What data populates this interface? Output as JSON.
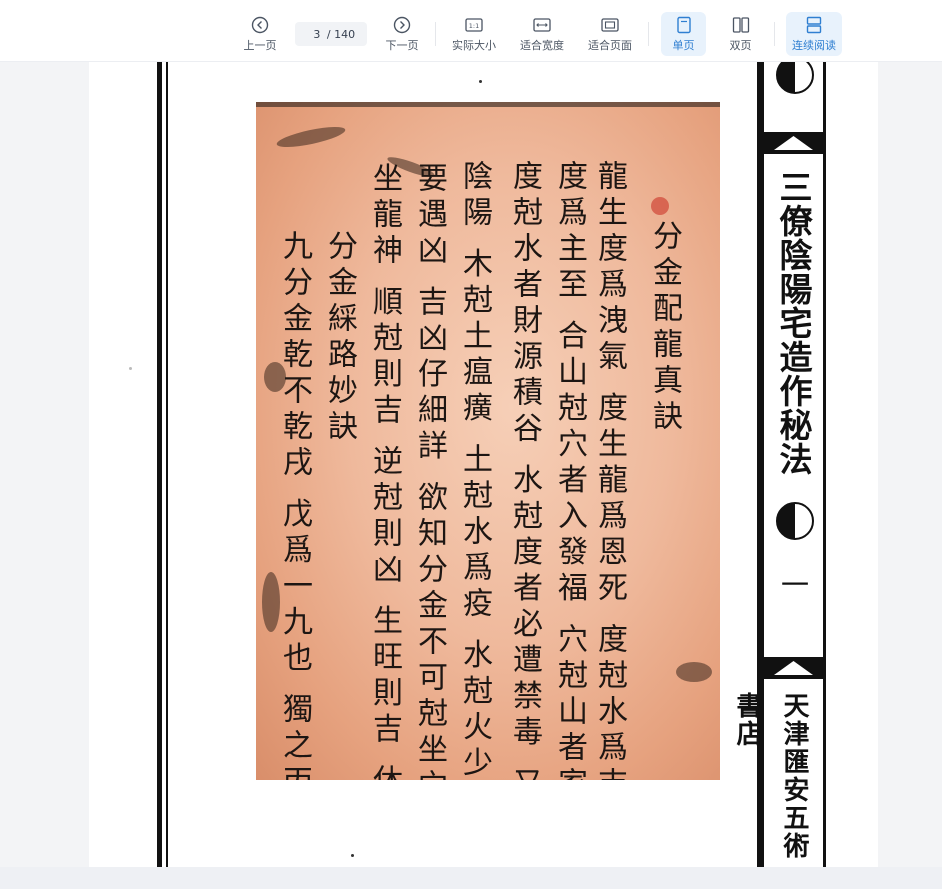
{
  "toolbar": {
    "prev_label": "上一页",
    "next_label": "下一页",
    "page_current": "3",
    "page_total": "/ 140",
    "actual_size_label": "实际大小",
    "actual_size_icon_text": "1:1",
    "fit_width_label": "适合宽度",
    "fit_page_label": "适合页面",
    "single_page_label": "单页",
    "double_page_label": "双页",
    "continuous_label": "连续阅读",
    "accent_color": "#2f7fd1",
    "active_modes": [
      "single_page",
      "continuous"
    ]
  },
  "document": {
    "spine_title": "三僚陰陽宅造作秘法",
    "spine_folio": "一",
    "spine_publisher": "天津匯安五術書店",
    "manuscript_columns": [
      "分金配龍真訣",
      "龍生度爲洩氣 度生龍爲恩死 度尅水爲吉氣",
      "度爲主至 合山尅穴者入發福 穴尅山者家",
      "度尅水者財源積谷 水尅度者必遭禁毒 又合金",
      "陰陽 木尅土瘟癀 土尅水爲疫 水尅火少亡 金",
      "要遇凶 吉凶仔細詳 欲知分金不可尅坐穴",
      "坐龍神 順尅則吉 逆尅則凶 生旺則吉 休囚",
      "分金綵路妙訣",
      "九分金乾不乾戌 戊爲一九也 獨之丙度"
    ]
  }
}
